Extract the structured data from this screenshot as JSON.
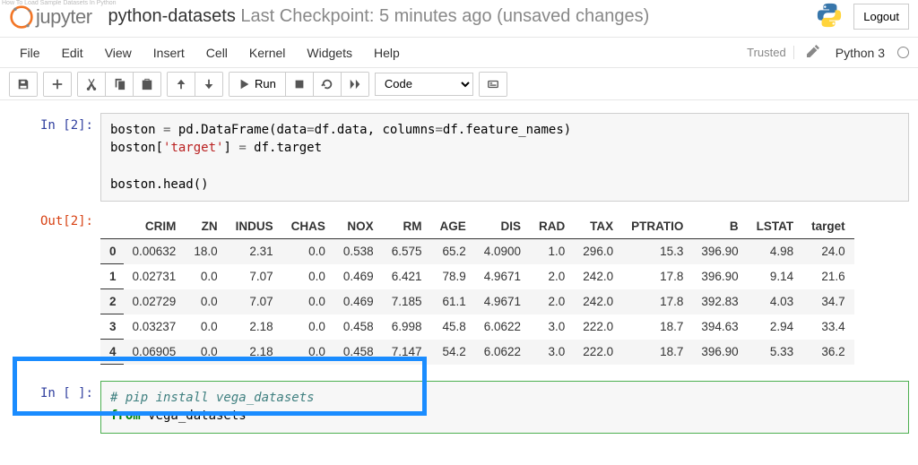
{
  "tiny_caption": "How To Load Sample Datasets In Python",
  "header": {
    "logo_text": "jupyter",
    "title_notebook": "python-datasets",
    "title_checkpoint": " Last Checkpoint: 5 minutes ago ",
    "title_status": " (unsaved changes)",
    "logout_label": "Logout"
  },
  "menu": {
    "items": [
      "File",
      "Edit",
      "View",
      "Insert",
      "Cell",
      "Kernel",
      "Widgets",
      "Help"
    ],
    "trusted": "Trusted",
    "kernel": "Python 3"
  },
  "toolbar": {
    "run_label": "Run",
    "celltype": "Code"
  },
  "cells": {
    "in2_prompt": "In [2]:",
    "in2_code_line1a": "boston ",
    "in2_code_line1b": "=",
    "in2_code_line1c": " pd.DataFrame(data",
    "in2_code_line1d": "=",
    "in2_code_line1e": "df.data, columns",
    "in2_code_line1f": "=",
    "in2_code_line1g": "df.feature_names)",
    "in2_code_line2a": "boston[",
    "in2_code_line2b": "'target'",
    "in2_code_line2c": "] ",
    "in2_code_line2d": "=",
    "in2_code_line2e": " df.target",
    "in2_code_line4": "boston.head()",
    "out2_prompt": "Out[2]:",
    "in3_prompt": "In [ ]:",
    "in3_line1": "# pip install vega_datasets",
    "in3_line2a": "from",
    "in3_line2b": " vega_datasets"
  },
  "chart_data": {
    "type": "table",
    "columns": [
      "CRIM",
      "ZN",
      "INDUS",
      "CHAS",
      "NOX",
      "RM",
      "AGE",
      "DIS",
      "RAD",
      "TAX",
      "PTRATIO",
      "B",
      "LSTAT",
      "target"
    ],
    "index": [
      "0",
      "1",
      "2",
      "3",
      "4"
    ],
    "rows": [
      [
        "0.00632",
        "18.0",
        "2.31",
        "0.0",
        "0.538",
        "6.575",
        "65.2",
        "4.0900",
        "1.0",
        "296.0",
        "15.3",
        "396.90",
        "4.98",
        "24.0"
      ],
      [
        "0.02731",
        "0.0",
        "7.07",
        "0.0",
        "0.469",
        "6.421",
        "78.9",
        "4.9671",
        "2.0",
        "242.0",
        "17.8",
        "396.90",
        "9.14",
        "21.6"
      ],
      [
        "0.02729",
        "0.0",
        "7.07",
        "0.0",
        "0.469",
        "7.185",
        "61.1",
        "4.9671",
        "2.0",
        "242.0",
        "17.8",
        "392.83",
        "4.03",
        "34.7"
      ],
      [
        "0.03237",
        "0.0",
        "2.18",
        "0.0",
        "0.458",
        "6.998",
        "45.8",
        "6.0622",
        "3.0",
        "222.0",
        "18.7",
        "394.63",
        "2.94",
        "33.4"
      ],
      [
        "0.06905",
        "0.0",
        "2.18",
        "0.0",
        "0.458",
        "7.147",
        "54.2",
        "6.0622",
        "3.0",
        "222.0",
        "18.7",
        "396.90",
        "5.33",
        "36.2"
      ]
    ]
  }
}
